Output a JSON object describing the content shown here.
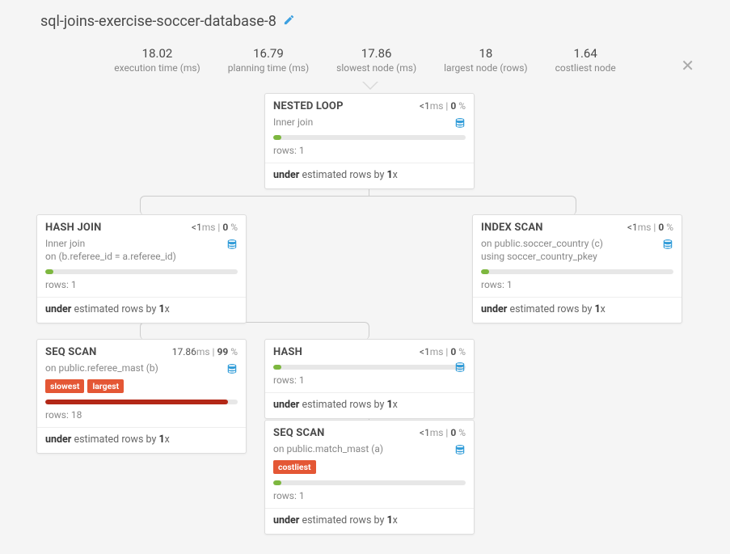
{
  "title": "sql-joins-exercise-soccer-database-8",
  "stats": [
    {
      "value": "18.02",
      "label": "execution time (ms)"
    },
    {
      "value": "16.79",
      "label": "planning time (ms)"
    },
    {
      "value": "17.86",
      "label": "slowest node (ms)"
    },
    {
      "value": "18",
      "label": "largest node (rows)"
    },
    {
      "value": "1.64",
      "label": "costliest node"
    }
  ],
  "nodes": {
    "n0": {
      "title": "NESTED LOOP",
      "ms": "<1",
      "pct": "0",
      "sub1_pre": "Inner ",
      "sub1_kw": "join",
      "rows": "1",
      "est_pre": "under",
      "est_mid": " estimated rows by ",
      "est_fac": "1",
      "est_suf": "x"
    },
    "n1": {
      "title": "HASH JOIN",
      "ms": "<1",
      "pct": "0",
      "sub1_pre": "Inner ",
      "sub1_kw": "join",
      "sub2_pre": "on ",
      "sub2_txt": "(b.referee_id = a.referee_id)",
      "rows": "1",
      "est_pre": "under",
      "est_mid": " estimated rows by ",
      "est_fac": "1",
      "est_suf": "x"
    },
    "n2": {
      "title": "INDEX SCAN",
      "ms": "<1",
      "pct": "0",
      "sub2_pre": "on ",
      "sub2_txt": "public.soccer_country (c)",
      "sub3_pre": "using ",
      "sub3_txt": "soccer_country_pkey",
      "rows": "1",
      "est_pre": "under",
      "est_mid": " estimated rows by ",
      "est_fac": "1",
      "est_suf": "x"
    },
    "n3": {
      "title": "SEQ SCAN",
      "ms": "17.86",
      "pct": "99",
      "sub2_pre": "on ",
      "sub2_txt": "public.referee_mast (b)",
      "badge1": "slowest",
      "badge2": "largest",
      "rows": "18",
      "est_pre": "under",
      "est_mid": " estimated rows by ",
      "est_fac": "1",
      "est_suf": "x"
    },
    "n4": {
      "title": "HASH",
      "ms": "<1",
      "pct": "0",
      "rows": "1",
      "est_pre": "under",
      "est_mid": " estimated rows by ",
      "est_fac": "1",
      "est_suf": "x"
    },
    "n5": {
      "title": "SEQ SCAN",
      "ms": "<1",
      "pct": "0",
      "sub2_pre": "on ",
      "sub2_txt": "public.match_mast (a)",
      "badge1": "costliest",
      "rows": "1",
      "est_pre": "under",
      "est_mid": " estimated rows by ",
      "est_fac": "1",
      "est_suf": "x"
    }
  },
  "labels": {
    "rows_prefix": "rows: ",
    "ms_suffix": "ms",
    "pct_suffix": " %"
  }
}
